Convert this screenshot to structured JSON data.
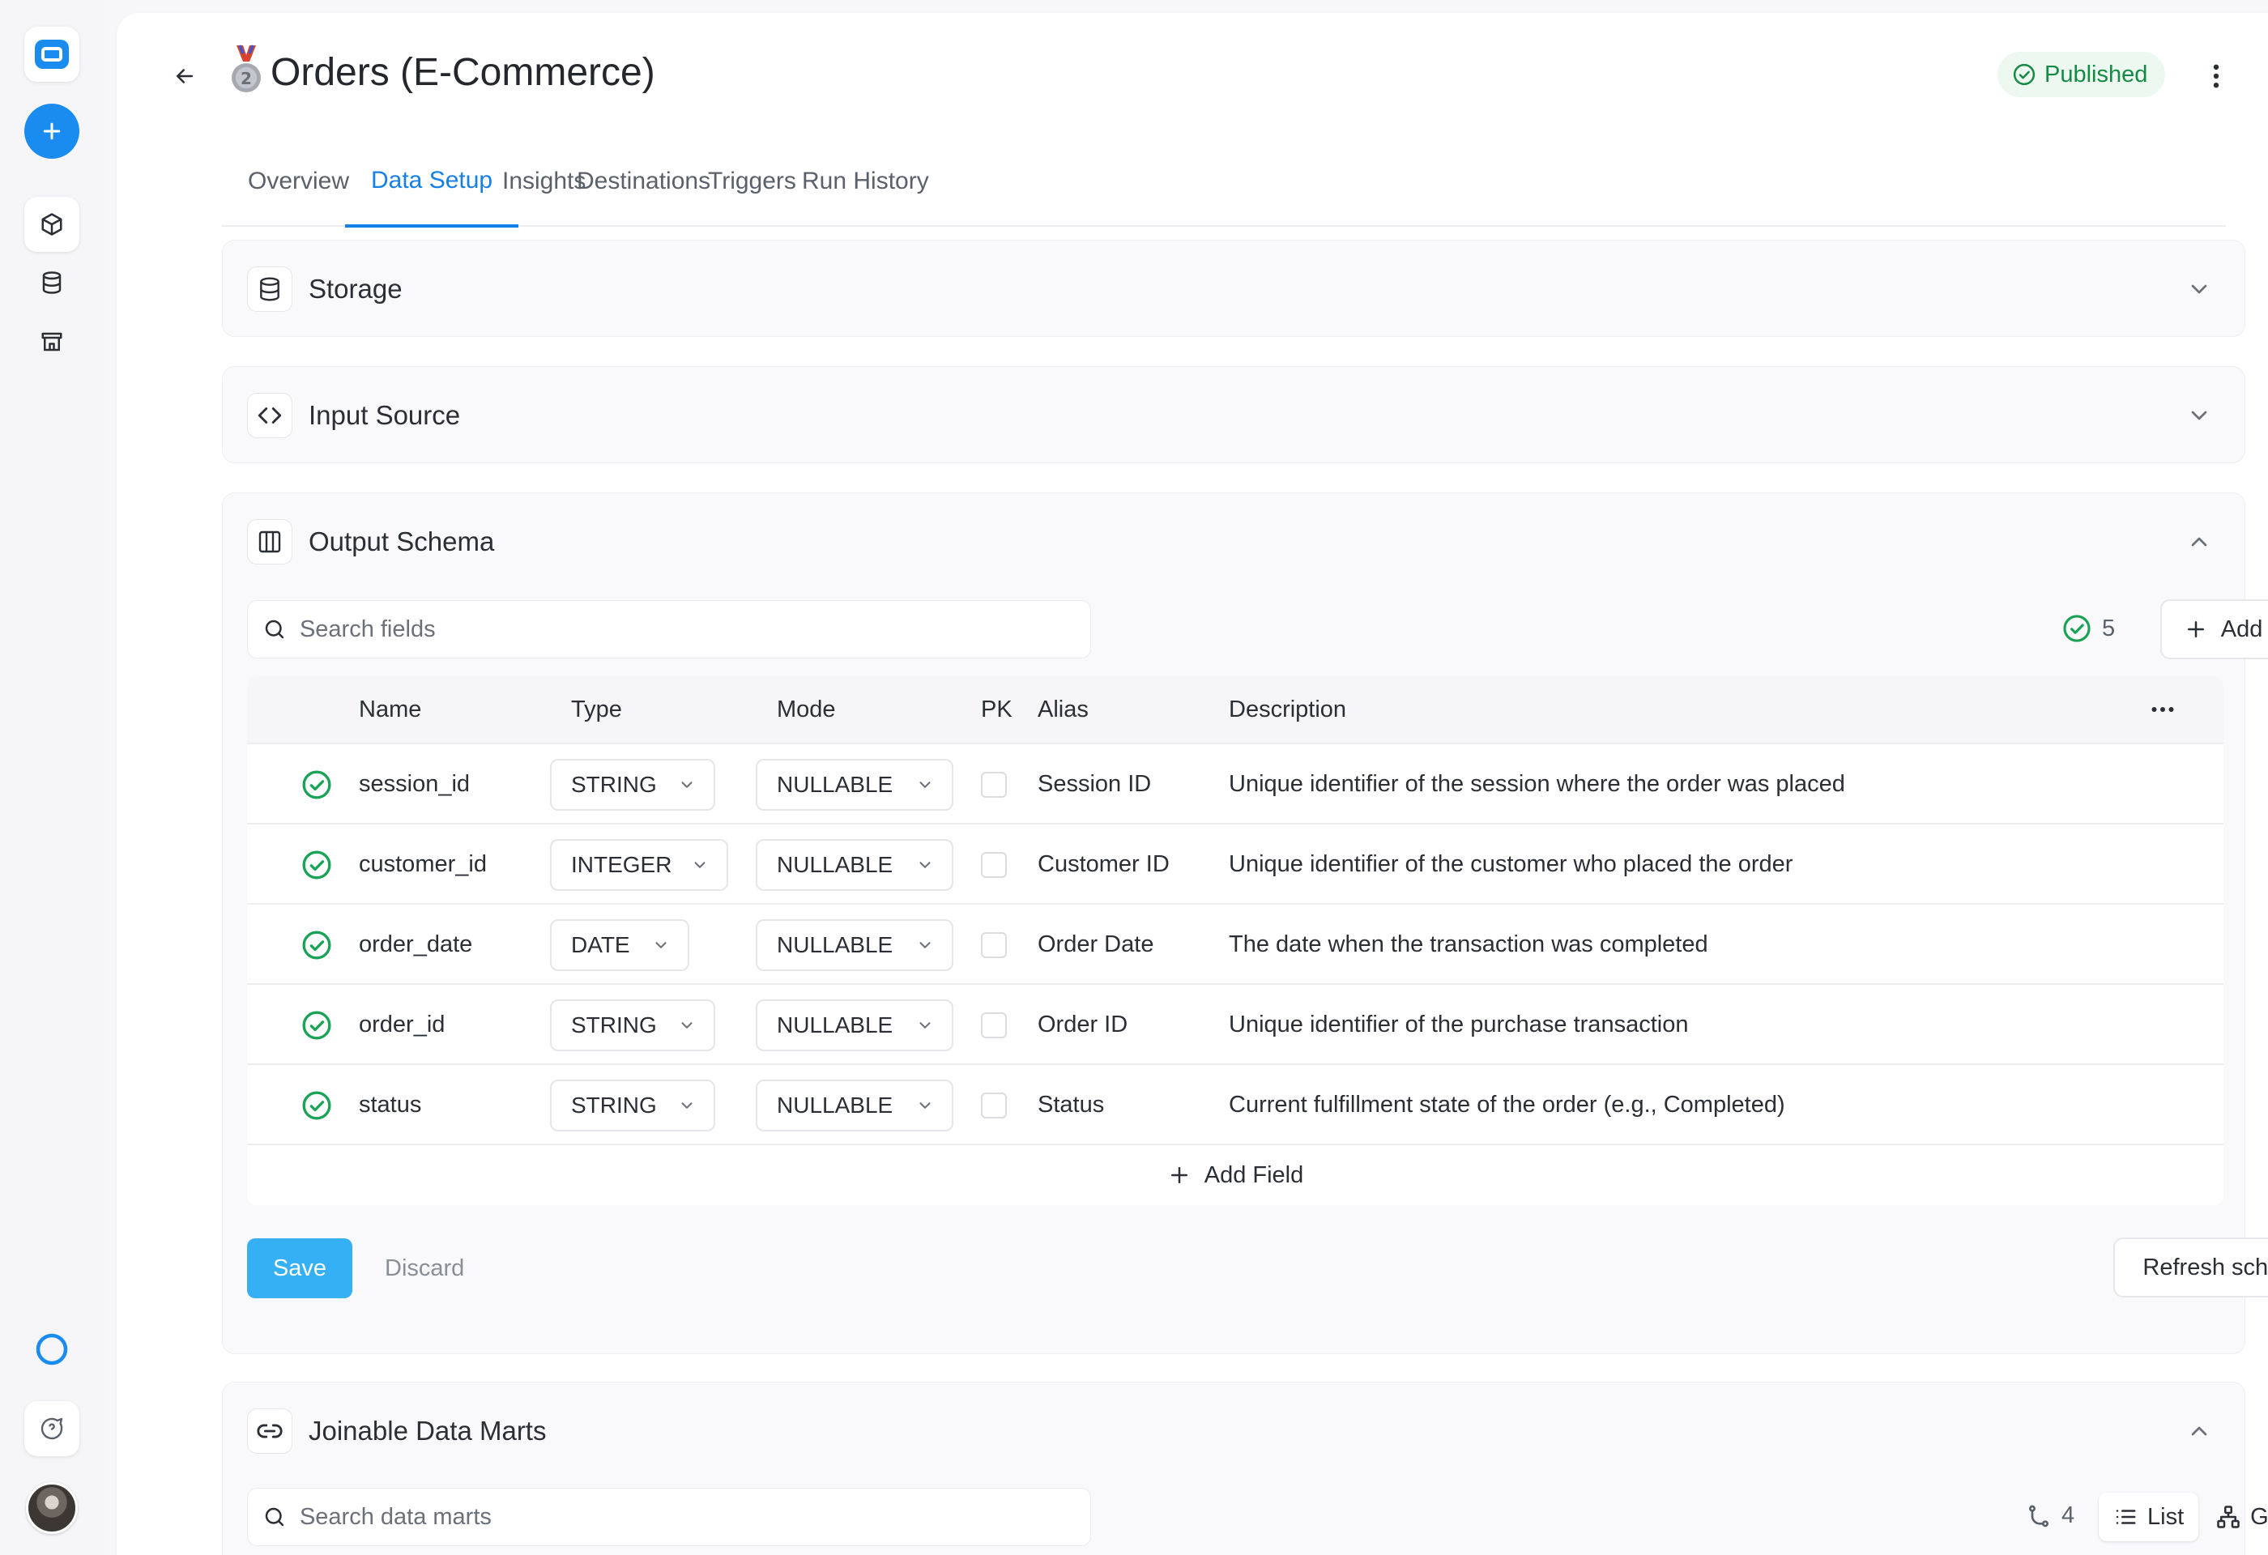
{
  "app": {
    "title": "Orders (E-Commerce)",
    "status_badge": "Published",
    "colors": {
      "accent": "#1680e6",
      "success": "#148a45",
      "save": "#36b0f5"
    }
  },
  "sidebar": {
    "icons": [
      "logo-icon",
      "plus-icon",
      "cube-icon",
      "database-icon",
      "store-icon",
      "ring-icon",
      "chat-icon",
      "avatar"
    ]
  },
  "tabs": [
    {
      "label": "Overview"
    },
    {
      "label": "Data Setup",
      "active": true
    },
    {
      "label": "Insights"
    },
    {
      "label": "Destinations"
    },
    {
      "label": "Triggers"
    },
    {
      "label": "Run History"
    }
  ],
  "sections": {
    "storage": {
      "title": "Storage"
    },
    "input_source": {
      "title": "Input Source"
    },
    "output_schema": {
      "title": "Output Schema",
      "search_placeholder": "Search fields",
      "count": "5",
      "add_field": "Add Field",
      "columns": {
        "name": "Name",
        "type": "Type",
        "mode": "Mode",
        "pk": "PK",
        "alias": "Alias",
        "description": "Description"
      },
      "rows": [
        {
          "name": "session_id",
          "type": "STRING",
          "mode": "NULLABLE",
          "alias": "Session ID",
          "description": "Unique identifier of the session where the order was placed"
        },
        {
          "name": "customer_id",
          "type": "INTEGER",
          "mode": "NULLABLE",
          "alias": "Customer ID",
          "description": "Unique identifier of the customer who placed the order"
        },
        {
          "name": "order_date",
          "type": "DATE",
          "mode": "NULLABLE",
          "alias": "Order Date",
          "description": "The date when the transaction was completed"
        },
        {
          "name": "order_id",
          "type": "STRING",
          "mode": "NULLABLE",
          "alias": "Order ID",
          "description": "Unique identifier of the purchase transaction"
        },
        {
          "name": "status",
          "type": "STRING",
          "mode": "NULLABLE",
          "alias": "Status",
          "description": "Current fulfillment state of the order (e.g., Completed)"
        }
      ],
      "add_field_row": "Add Field",
      "save": "Save",
      "discard": "Discard",
      "refresh": "Refresh schema"
    },
    "joinable": {
      "title": "Joinable Data Marts",
      "search_placeholder": "Search data marts",
      "count": "4",
      "view_list": "List",
      "view_graph": "Graph"
    }
  }
}
